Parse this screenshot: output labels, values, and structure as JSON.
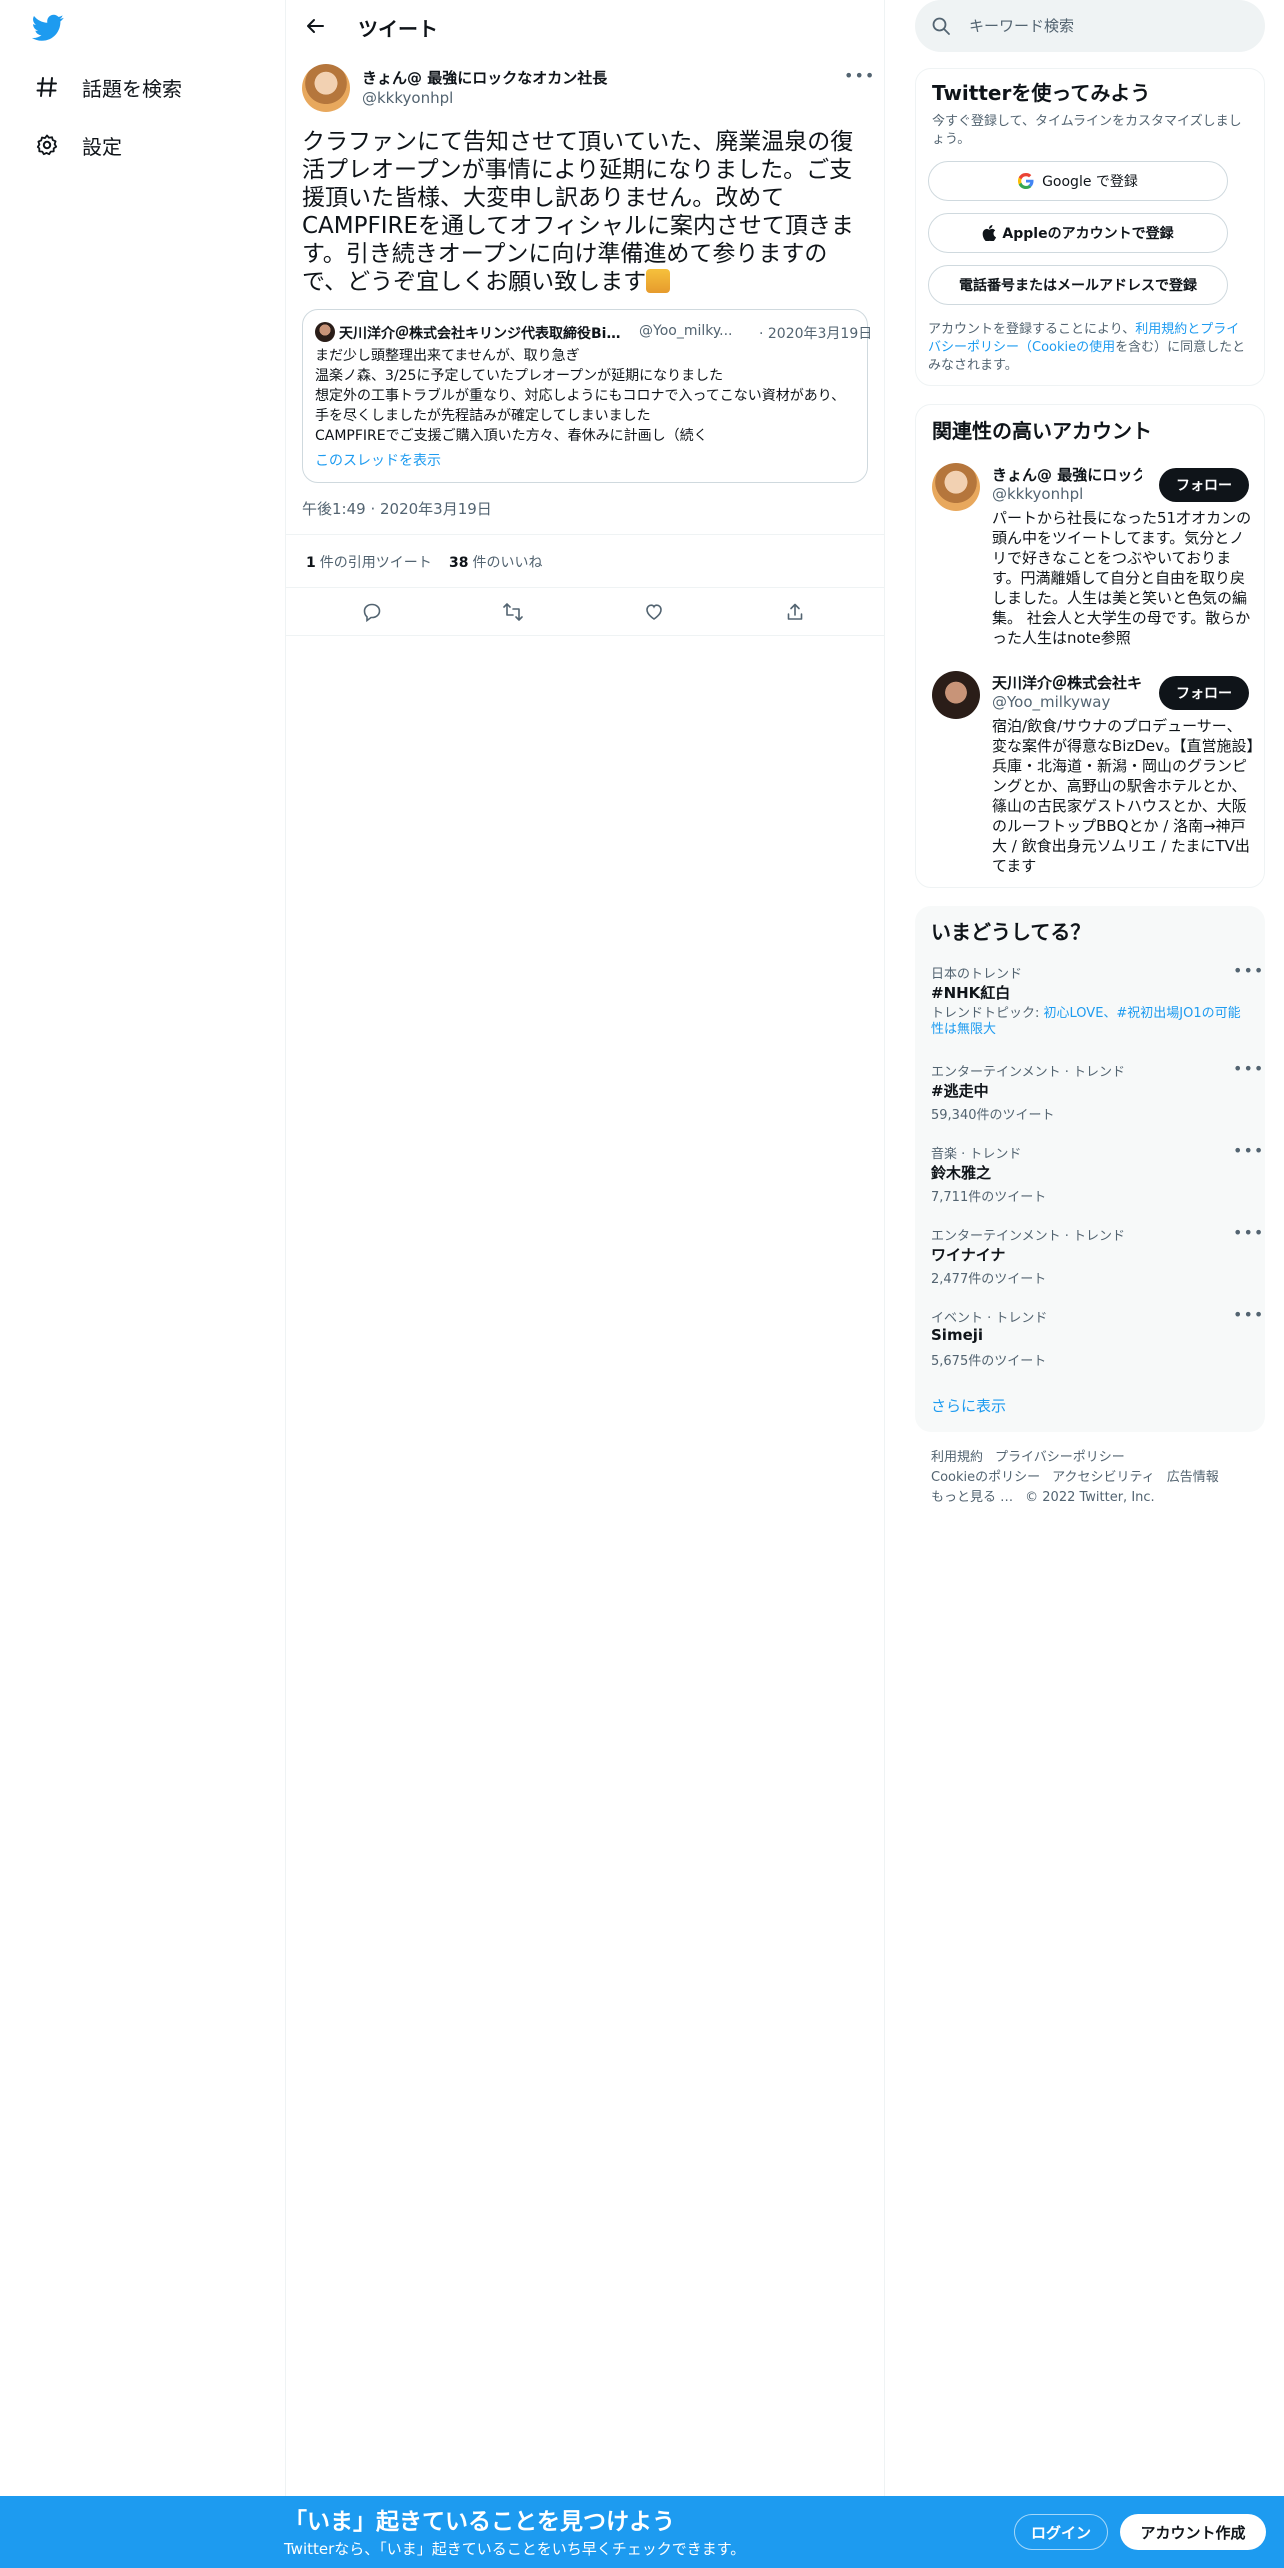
{
  "nav": {
    "logo_icon": "twitter-bird-icon",
    "items": [
      {
        "label": "話題を検索",
        "icon": "hashtag-icon"
      },
      {
        "label": "設定",
        "icon": "gear-icon"
      }
    ]
  },
  "header": {
    "title": "ツイート"
  },
  "tweet": {
    "author_name": "きょん@ 最強にロックなオカン社長",
    "author_handle": "@kkkyonhpl",
    "text": "クラファンにて告知させて頂いていた、廃業温泉の復活プレオープンが事情により延期になりました。ご支援頂いた皆様、大変申し訳ありません。改めてCAMPFIREを通してオフィシャルに案内させて頂きます。引き続きオープンに向け準備進めて参りますので、どうぞ宜しくお願い致します",
    "timestamp": "午後1:49 · 2020年3月19日",
    "quote_tweets": "1",
    "quote_label": "件の引用ツイート",
    "likes": "38",
    "likes_label": "件のいいね",
    "quote": {
      "name": "天川洋介＠株式会社キリンジ代表取締役Bi…",
      "handle": "@Yoo_milky...",
      "date": "· 2020年3月19日",
      "lines": [
        "まだ少し頭整理出来てませんが、取り急ぎ",
        "温楽ノ森、3/25に予定していたプレオープンが延期になりました",
        "想定外の工事トラブルが重なり、対応しようにもコロナで入ってこない資材があり、手を尽くしましたが先程詰みが確定してしまいました",
        "CAMPFIREでご支援ご購入頂いた方々、春休みに計画し（続く"
      ],
      "link": "このスレッドを表示"
    }
  },
  "search": {
    "placeholder": "キーワード検索"
  },
  "signup": {
    "title": "Twitterを使ってみよう",
    "desc": "今すぐ登録して、タイムラインをカスタマイズしましょう。",
    "google": "Google で登録",
    "apple": "Appleのアカウントで登録",
    "phone": "電話番号またはメールアドレスで登録",
    "legal_pre": "アカウントを登録することにより、",
    "legal_link": "利用規約とプライバシーポリシー（Cookieの使用",
    "legal_post": "を含む）に同意したとみなされます。"
  },
  "related": {
    "title": "関連性の高いアカウント",
    "follow_label": "フォロー",
    "accounts": [
      {
        "name": "きょん@ 最強にロックなオカン社長",
        "handle": "@kkkyonhpl",
        "bio": "パートから社長になった51才オカンの頭ん中をツイートしてます。気分とノリで好きなことをつぶやいております。円満離婚して自分と自由を取り戻しました。人生は美と笑いと色気の編集。 社会人と大学生の母です。散らかった人生はnote参照"
      },
      {
        "name": "天川洋介＠株式会社キリンジ代表取締役",
        "handle": "@Yoo_milkyway",
        "bio": "宿泊/飲食/サウナのプロデューサー、変な案件が得意なBizDev。【直営施設】兵庫・北海道・新潟・岡山のグランピングとか、高野山の駅舎ホテルとか、篠山の古民家ゲストハウスとか、大阪のルーフトップBBQとか / 洛南→神戸大 / 飲食出身元ソムリエ / たまにTV出てます"
      }
    ]
  },
  "trends": {
    "title": "いまどうしてる？",
    "items": [
      {
        "context": "日本のトレンド",
        "name": "#NHK紅白",
        "topic_pre": "トレンドトピック: ",
        "topic": "初心LOVE、#祝初出場JO1の可能性は無限大"
      },
      {
        "context": "エンターテインメント · トレンド",
        "name": "#逃走中",
        "count": "59,340件のツイート"
      },
      {
        "context": "音楽 · トレンド",
        "name": "鈴木雅之",
        "count": "7,711件のツイート"
      },
      {
        "context": "エンターテインメント · トレンド",
        "name": "ワイナイナ",
        "count": "2,477件のツイート"
      },
      {
        "context": "イベント · トレンド",
        "name": "Simeji",
        "count": "5,675件のツイート"
      }
    ],
    "show_more": "さらに表示"
  },
  "footer": {
    "links": [
      "利用規約",
      "プライバシーポリシー",
      "Cookieのポリシー",
      "アクセシビリティ",
      "広告情報",
      "もっと見る …"
    ],
    "copyright": "© 2022 Twitter, Inc."
  },
  "bottom": {
    "title": "「いま」起きていることを見つけよう",
    "subtitle": "Twitterなら、「いま」起きていることをいち早くチェックできます。",
    "login": "ログイン",
    "signup": "アカウント作成"
  },
  "colors": {
    "accent": "#1d9bf0",
    "text": "#0f1419",
    "muted": "#536471"
  }
}
